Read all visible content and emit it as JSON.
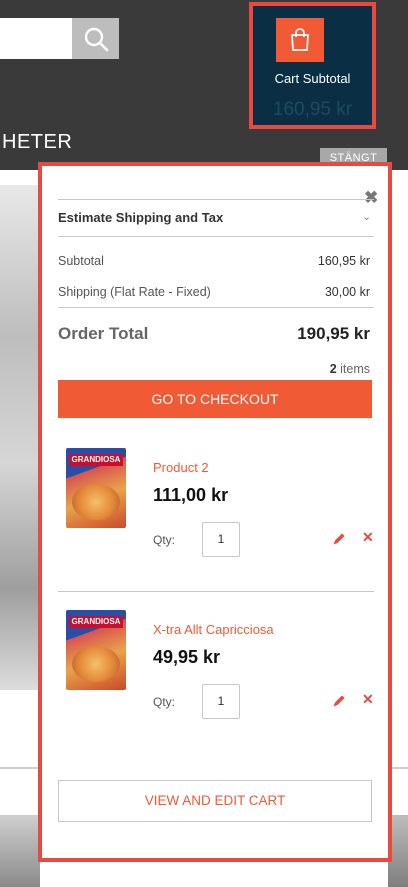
{
  "header": {
    "nav_label": "HETER",
    "close_badge": "STÄNGT"
  },
  "cart_block": {
    "label": "Cart Subtotal",
    "amount": "160,95 kr"
  },
  "minicart": {
    "estimate_label": "Estimate Shipping and Tax",
    "subtotal_label": "Subtotal",
    "subtotal_value": "160,95 kr",
    "shipping_label": "Shipping (Flat Rate - Fixed)",
    "shipping_value": "30,00 kr",
    "order_total_label": "Order Total",
    "order_total_value": "190,95 kr",
    "item_count": "2",
    "item_count_suffix": " items",
    "checkout_label": "GO TO CHECKOUT",
    "view_cart_label": "VIEW AND EDIT CART",
    "qty_label": "Qty:",
    "items": [
      {
        "name": "Product 2",
        "price": "111,00 kr",
        "qty": "1",
        "brand": "GRANDIOSA"
      },
      {
        "name": "X-tra Allt Capricciosa",
        "price": "49,95 kr",
        "qty": "1",
        "brand": "GRANDIOSA"
      }
    ]
  },
  "colors": {
    "accent": "#f05a35",
    "highlight_border": "#e94a3f",
    "cart_bg": "#0a2e43",
    "header_bg": "#3a3a3a"
  },
  "icons": {
    "search": "search-icon",
    "cart": "shopping-bag-icon",
    "close": "close-icon",
    "edit": "pencil-icon",
    "remove": "remove-icon",
    "chevron": "chevron-down-icon"
  }
}
